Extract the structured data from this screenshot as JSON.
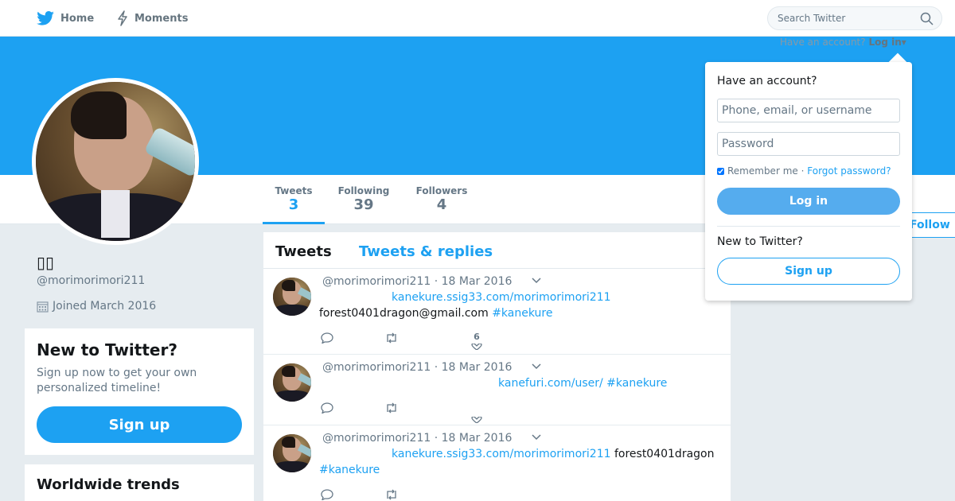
{
  "nav": {
    "home_label": "Home",
    "moments_label": "Moments",
    "search_placeholder": "Search Twitter"
  },
  "colors": {
    "brand": "#1da1f2",
    "banner": "#1da1f2",
    "page_bg": "#e6ecf0"
  },
  "login_prompt": {
    "text": "Have an account?",
    "link": "Log in"
  },
  "profile": {
    "name": "▯▯",
    "handle": "@morimorimori211",
    "joined": "Joined March 2016",
    "stats": [
      {
        "label": "Tweets",
        "value": "3"
      },
      {
        "label": "Following",
        "value": "39"
      },
      {
        "label": "Followers",
        "value": "4"
      }
    ],
    "follow_label": "Follow"
  },
  "sidebar": {
    "new_to_twitter": {
      "title": "New to Twitter?",
      "text": "Sign up now to get your own personalized timeline!",
      "button": "Sign up"
    },
    "trends_title": "Worldwide trends"
  },
  "timeline": {
    "tabs": [
      "Tweets",
      "Tweets & replies"
    ],
    "tweets": [
      {
        "handle": "@morimorimori211",
        "date": "· 18 Mar 2016",
        "link1": "kanekure.ssig33.com/morimorimori211",
        "text": "forest0401dragon@gmail.com",
        "hashtag": "#kanekure",
        "likes": "6"
      },
      {
        "handle": "@morimorimori211",
        "date": "· 18 Mar 2016",
        "link1": "kanefuri.com/user/",
        "hashtag": "#kanekure"
      },
      {
        "handle": "@morimorimori211",
        "date": "· 18 Mar 2016",
        "link1": "kanekure.ssig33.com/morimorimori211",
        "text": "forest0401dragon",
        "hashtag": "#kanekure"
      }
    ]
  },
  "login_dropdown": {
    "title": "Have an account?",
    "username_placeholder": "Phone, email, or username",
    "password_placeholder": "Password",
    "remember": "Remember me",
    "separator": "·",
    "forgot": "Forgot password?",
    "login_button": "Log in",
    "new_label": "New to Twitter?",
    "signup_button": "Sign up"
  }
}
